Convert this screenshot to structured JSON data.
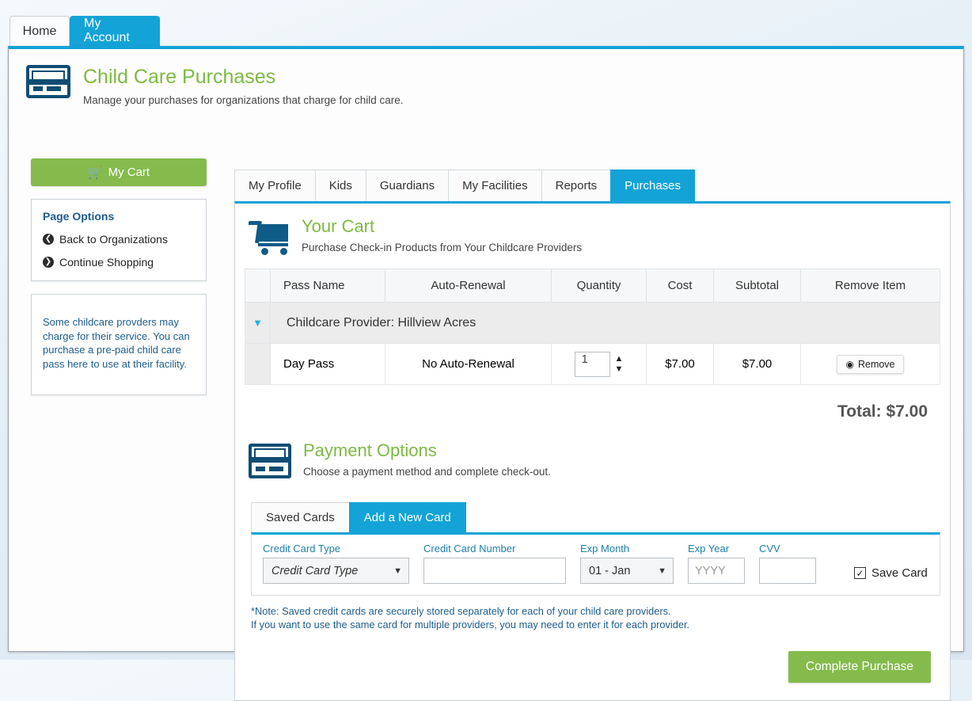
{
  "top_tabs": [
    {
      "label": "Home",
      "active": false
    },
    {
      "label": "My Account",
      "active": true
    }
  ],
  "page_header": {
    "title": "Child Care Purchases",
    "subtitle": "Manage your purchases for organizations that charge for child care.",
    "icon": "credit-card-icon"
  },
  "sidebar": {
    "cart_button": {
      "label": "My Cart",
      "icon": "shopping-cart-icon",
      "color": "#84bb4c"
    },
    "page_options": {
      "title": "Page Options",
      "links": [
        {
          "label": "Back to Organizations",
          "icon": "arrow-left-circle-icon"
        },
        {
          "label": "Continue Shopping",
          "icon": "arrow-right-circle-icon"
        }
      ]
    },
    "info_text": "Some childcare provders may charge for their service. You can purchase a pre-paid child care pass here to use at their facility."
  },
  "sub_tabs": [
    {
      "label": "My Profile",
      "active": false
    },
    {
      "label": "Kids",
      "active": false
    },
    {
      "label": "Guardians",
      "active": false
    },
    {
      "label": "My Facilities",
      "active": false
    },
    {
      "label": "Reports",
      "active": false
    },
    {
      "label": "Purchases",
      "active": true
    }
  ],
  "cart_section": {
    "title": "Your Cart",
    "subtitle": "Purchase Check-in Products from Your Childcare Providers",
    "icon": "shopping-cart-icon",
    "columns": [
      "",
      "Pass Name",
      "Auto-Renewal",
      "Quantity",
      "Cost",
      "Subtotal",
      "Remove Item"
    ],
    "group": {
      "label": "Childcare Provider: Hillview Acres",
      "toggle_icon": "triangle-down-icon"
    },
    "rows": [
      {
        "pass_name": "Day Pass",
        "auto_renewal": "No Auto-Renewal",
        "quantity": "1",
        "cost": "$7.00",
        "subtotal": "$7.00",
        "remove_label": "Remove",
        "remove_icon": "remove-circle-icon"
      }
    ],
    "total": "Total: $7.00"
  },
  "payment_section": {
    "title": "Payment Options",
    "subtitle": "Choose a payment method and complete check-out.",
    "icon": "credit-card-icon",
    "tabs": [
      {
        "label": "Saved Cards",
        "active": false
      },
      {
        "label": "Add a New Card",
        "active": true
      }
    ],
    "fields": {
      "card_type": {
        "label": "Credit Card Type",
        "value": "Credit Card Type",
        "dropdown_icon": "chevron-down-icon"
      },
      "card_number": {
        "label": "Credit Card Number",
        "value": "",
        "placeholder": ""
      },
      "exp_month": {
        "label": "Exp Month",
        "value": "01 - Jan",
        "dropdown_icon": "chevron-down-icon"
      },
      "exp_year": {
        "label": "Exp Year",
        "value": "",
        "placeholder": "YYYY"
      },
      "cvv": {
        "label": "CVV",
        "value": "",
        "placeholder": ""
      },
      "save_card": {
        "label": "Save Card",
        "checked": true,
        "check_glyph": "✓"
      }
    },
    "note_line1": "*Note: Saved credit cards are securely stored separately for each of your child care providers.",
    "note_line2": "If you want to use the same card for multiple providers, you may need to enter it for each provider.",
    "complete_button": {
      "label": "Complete Purchase",
      "color": "#84bb4c"
    }
  }
}
